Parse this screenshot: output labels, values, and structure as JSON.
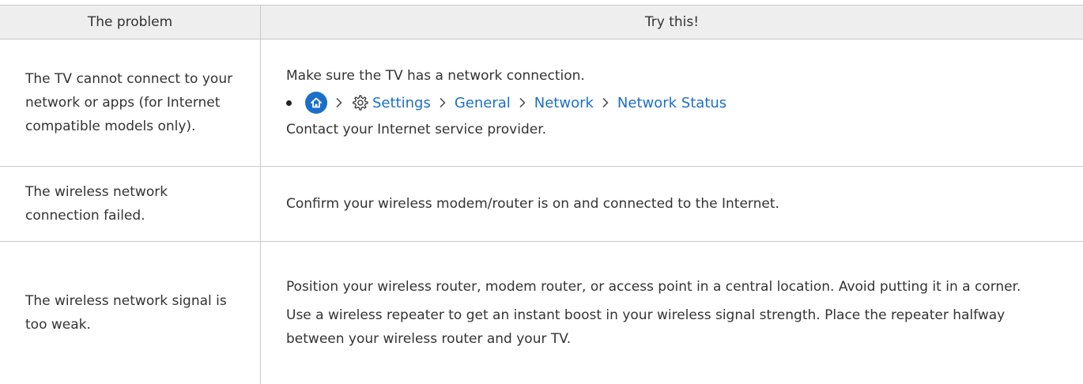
{
  "header": {
    "problem": "The problem",
    "try": "Try this!"
  },
  "rows": [
    {
      "problem": "The TV cannot connect to your network or apps (for Internet compatible models only).",
      "line1": "Make sure the TV has a network connection.",
      "path": {
        "home_icon": "home-icon",
        "settings_icon": "gear-icon",
        "settings": "Settings",
        "general": "General",
        "network": "Network",
        "network_status": "Network Status"
      },
      "line2": "Contact your Internet service provider."
    },
    {
      "problem": "The wireless network connection failed.",
      "line1": "Confirm your wireless modem/router is on and connected to the Internet."
    },
    {
      "problem": "The wireless network signal is too weak.",
      "line1": "Position your wireless router, modem router, or access point in a central location. Avoid putting it in a corner.",
      "line2": "Use a wireless repeater to get an instant boost in your wireless signal strength. Place the repeater halfway between your wireless router and your TV."
    }
  ],
  "colors": {
    "link": "#1b6fc9",
    "header_bg": "#eeeeee",
    "border": "#c8c8c8",
    "text": "#333333"
  }
}
